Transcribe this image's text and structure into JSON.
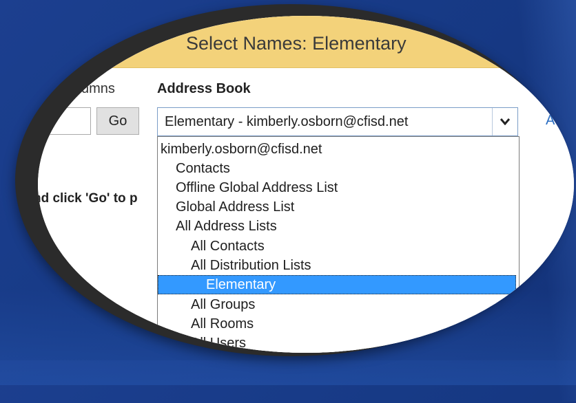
{
  "dialog": {
    "title": "Select Names: Elementary"
  },
  "toolbar": {
    "columns_label": "umns",
    "address_book_label": "Address Book",
    "search_value": "",
    "go_label": "Go",
    "advanced_link": "Ad"
  },
  "address_book": {
    "selected_value": "Elementary - kimberly.osborn@cfisd.net",
    "options": [
      {
        "label": "kimberly.osborn@cfisd.net",
        "level": 0
      },
      {
        "label": "Contacts",
        "level": 1
      },
      {
        "label": "Offline Global Address List",
        "level": 1
      },
      {
        "label": "Global Address List",
        "level": 1
      },
      {
        "label": "All Address Lists",
        "level": 1
      },
      {
        "label": "All Contacts",
        "level": 2
      },
      {
        "label": "All Distribution Lists",
        "level": 2
      },
      {
        "label": "Elementary",
        "level": 3,
        "selected": true
      },
      {
        "label": "All Groups",
        "level": 2
      },
      {
        "label": "All Rooms",
        "level": 2
      },
      {
        "label": "All Users",
        "level": 2
      }
    ]
  },
  "hint_text": "nd click 'Go' to p",
  "colors": {
    "title_bar": "#f3d27a",
    "selection": "#3399ff",
    "link": "#2a6dc2",
    "background": "#1c3f8f"
  }
}
